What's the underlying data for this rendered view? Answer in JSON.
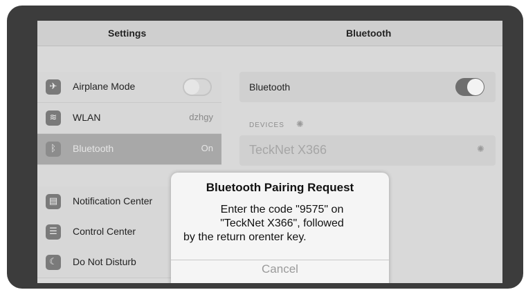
{
  "header": {
    "left_title": "Settings",
    "right_title": "Bluetooth"
  },
  "sidebar": {
    "group1": [
      {
        "label": "Airplane Mode",
        "icon": "airplane-icon",
        "glyph": "✈",
        "value": ""
      },
      {
        "label": "WLAN",
        "icon": "wifi-icon",
        "glyph": "≋",
        "value": "dzhgy"
      },
      {
        "label": "Bluetooth",
        "icon": "bluetooth-icon",
        "glyph": "ᛒ",
        "value": "On"
      }
    ],
    "group2": [
      {
        "label": "Notification Center",
        "icon": "notification-center-icon",
        "glyph": "▤"
      },
      {
        "label": "Control Center",
        "icon": "control-center-icon",
        "glyph": "☰"
      },
      {
        "label": "Do Not Disturb",
        "icon": "moon-icon",
        "glyph": "☾"
      }
    ]
  },
  "main": {
    "bluetooth_label": "Bluetooth",
    "bluetooth_on": true,
    "devices_header": "DEVICES",
    "device_name": "TeckNet X366"
  },
  "dialog": {
    "title": "Bluetooth Pairing Request",
    "message_lines": [
      "Enter the code \"9575\" on",
      "\"TeckNet X366\", followed",
      "by the return orenter key."
    ],
    "cancel_label": "Cancel"
  },
  "colors": {
    "bezel": "#3c3c3c",
    "screen": "#d9d9d9",
    "selected_row": "#a8a8a8",
    "dialog": "#f5f5f5"
  }
}
